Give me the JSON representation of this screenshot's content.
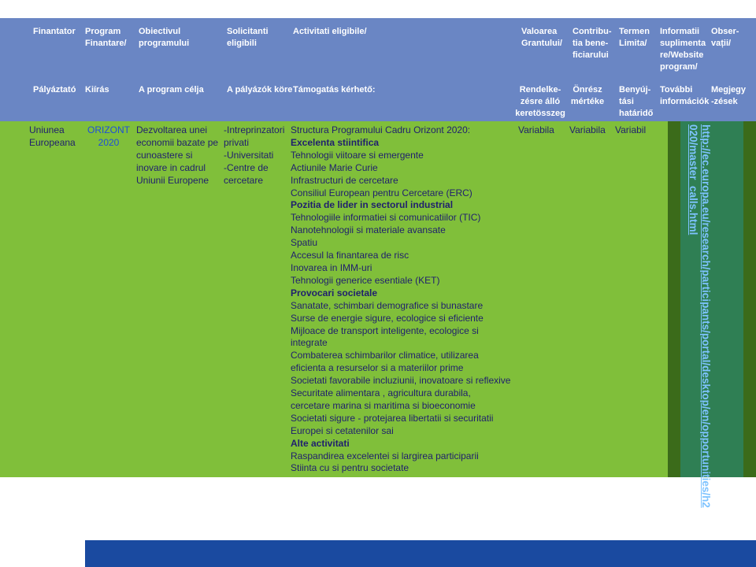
{
  "header_ro": {
    "finantator": "Finantator",
    "program": [
      "Program",
      "Finantare/"
    ],
    "obiectiv": [
      "Obiectivul",
      "programului"
    ],
    "solicitanti": [
      "Solicitanti",
      "eligibili"
    ],
    "activitati": "Activitati eligibile/",
    "valoarea": [
      "Valoarea",
      "Grantului/"
    ],
    "contributia": [
      "Contribu-",
      "tia bene-",
      "ficiarului"
    ],
    "termen": [
      "Termen",
      "Limita/"
    ],
    "informatii": [
      "Informatii",
      "suplimenta",
      "re/Website",
      "program/"
    ],
    "observatii": [
      "Obser-",
      "vații/"
    ]
  },
  "header_hu": {
    "palyaztato": "Pályáztató",
    "kiiras": "Kiírás",
    "program_celja": "A program célja",
    "palyazok_kore": "A pályázók köre",
    "tamogatas": "Támogatás kérhető:",
    "rendelkezesre": [
      "Rendelke-",
      "zésre álló",
      "keretösszeg"
    ],
    "onresz": [
      "Önrész",
      "mértéke"
    ],
    "benyujtasi": [
      "Benyúj-",
      "tási",
      "határidő"
    ],
    "tovabbi": [
      "További",
      "információk"
    ],
    "megjegyzesek": [
      "Megjegy",
      "-zések"
    ]
  },
  "row": {
    "finantator": [
      "Uniunea",
      "Europeana"
    ],
    "program": [
      "ORIZONT",
      "2020"
    ],
    "obiectiv": [
      "Dezvoltarea unei",
      "economii bazate pe",
      "cunoastere si",
      "inovare in cadrul",
      "Uniunii Europene"
    ],
    "solicitanti": [
      "-Intreprinzatori",
      "privati",
      "-Universitati",
      "-Centre de",
      "cercetare"
    ],
    "activitati": [
      {
        "text": "Structura Programului Cadru Orizont 2020:",
        "bold": false
      },
      {
        "text": "Excelenta stiintifica",
        "bold": true
      },
      {
        "text": "Tehnologii viitoare si emergente",
        "bold": false
      },
      {
        "text": "Actiunile Marie Curie",
        "bold": false
      },
      {
        "text": "Infrastructuri de cercetare",
        "bold": false
      },
      {
        "text": "Consiliul European pentru Cercetare (ERC)",
        "bold": false
      },
      {
        "text": "Pozitia de lider in sectorul industrial",
        "bold": true
      },
      {
        "text": "Tehnologiile informatiei si comunicatiilor (TIC)",
        "bold": false
      },
      {
        "text": "Nanotehnologii si materiale avansate",
        "bold": false
      },
      {
        "text": "Spatiu",
        "bold": false
      },
      {
        "text": "Accesul la finantarea de risc",
        "bold": false
      },
      {
        "text": "Inovarea in IMM-uri",
        "bold": false
      },
      {
        "text": "Tehnologii generice esentiale (KET)",
        "bold": false
      },
      {
        "text": "Provocari societale",
        "bold": true
      },
      {
        "text": "Sanatate, schimbari demografice si bunastare",
        "bold": false
      },
      {
        "text": "Surse de energie sigure, ecologice si eficiente",
        "bold": false
      },
      {
        "text": "Mijloace de transport inteligente, ecologice si",
        "bold": false
      },
      {
        "text": "integrate",
        "bold": false
      },
      {
        "text": "Combaterea schimbarilor climatice, utilizarea",
        "bold": false
      },
      {
        "text": "eficienta a resurselor si a materiilor prime",
        "bold": false
      },
      {
        "text": "Societati favorabile incluziunii, inovatoare si reflexive",
        "bold": false
      },
      {
        "text": "Securitate alimentara , agricultura durabila,",
        "bold": false
      },
      {
        "text": "cercetare marina si maritima si bioeconomie",
        "bold": false
      },
      {
        "text": "Societati sigure - protejarea libertatii si securitatii",
        "bold": false
      },
      {
        "text": "Europei si cetatenilor sai",
        "bold": false
      },
      {
        "text": "Alte activitati",
        "bold": true
      },
      {
        "text": "Raspandirea excelentei si largirea participarii",
        "bold": false
      },
      {
        "text": "Stiinta cu si pentru societate",
        "bold": false
      }
    ],
    "valoarea": "Variabila",
    "contributia": "Variabila",
    "termen": "Variabil",
    "website_lines": [
      "http://ec.europa.eu/research/participants/portal/desktop/en/opportunities/h2",
      "020/master_calls.html"
    ]
  },
  "colors": {
    "header": "#6a86c4",
    "row": "#80bf3a",
    "link": "#7ec3ff",
    "footer": "#1a4aa0"
  }
}
